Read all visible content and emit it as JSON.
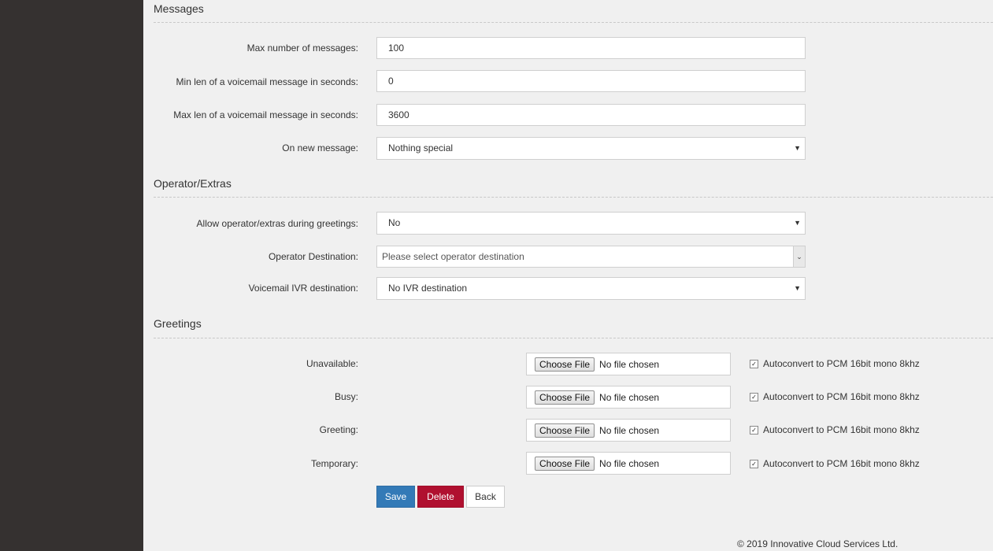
{
  "sections": {
    "messages": {
      "title": "Messages",
      "max_messages": {
        "label": "Max number of messages:",
        "value": "100"
      },
      "min_len": {
        "label": "Min len of a voicemail message in seconds:",
        "value": "0"
      },
      "max_len": {
        "label": "Max len of a voicemail message in seconds:",
        "value": "3600"
      },
      "on_new": {
        "label": "On new message:",
        "value": "Nothing special"
      }
    },
    "operator": {
      "title": "Operator/Extras",
      "allow": {
        "label": "Allow operator/extras during greetings:",
        "value": "No"
      },
      "destination": {
        "label": "Operator Destination:",
        "placeholder": "Please select operator destination"
      },
      "ivr": {
        "label": "Voicemail IVR destination:",
        "value": "No IVR destination"
      }
    },
    "greetings": {
      "title": "Greetings",
      "choose_label": "Choose File",
      "no_file": "No file chosen",
      "autoconvert_label": "Autoconvert to PCM 16bit mono 8khz",
      "items": [
        {
          "label": "Unavailable:",
          "autoconvert": true
        },
        {
          "label": "Busy:",
          "autoconvert": true
        },
        {
          "label": "Greeting:",
          "autoconvert": true
        },
        {
          "label": "Temporary:",
          "autoconvert": true
        }
      ]
    }
  },
  "buttons": {
    "save": "Save",
    "delete": "Delete",
    "back": "Back"
  },
  "footer": "© 2019 Innovative Cloud Services Ltd.",
  "colors": {
    "sidebar": "#353130",
    "save": "#337ab7",
    "delete": "#b01030"
  }
}
